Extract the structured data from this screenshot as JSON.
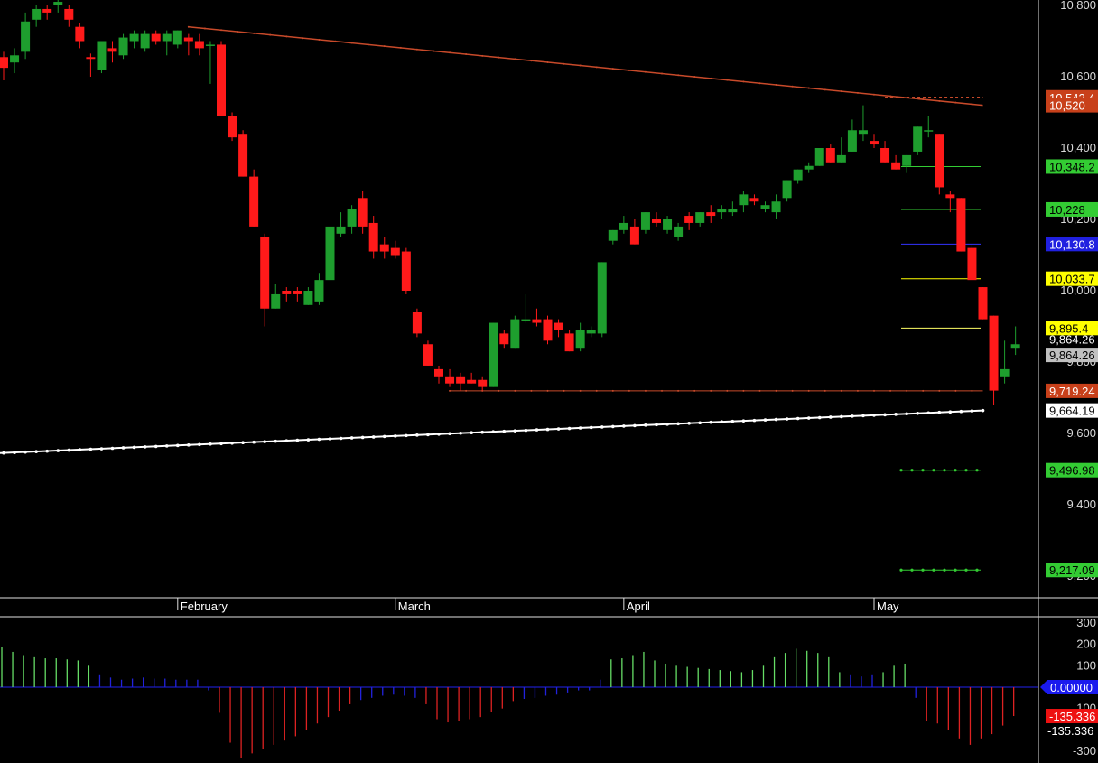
{
  "chart_data": [
    {
      "type": "candlestick",
      "ylim": [
        9160,
        10820
      ],
      "price_ticks": [
        "10,800",
        "10,600",
        "10,400",
        "10,200",
        "10,000",
        "9,800",
        "9,600",
        "9,400",
        "9,200"
      ],
      "month_labels": [
        {
          "label": "February",
          "bar": 16
        },
        {
          "label": "March",
          "bar": 36
        },
        {
          "label": "April",
          "bar": 57
        },
        {
          "label": "May",
          "bar": 80
        }
      ],
      "candles": [
        [
          10655,
          10670,
          10590,
          10625
        ],
        [
          10640,
          10680,
          10610,
          10660
        ],
        [
          10670,
          10780,
          10650,
          10755
        ],
        [
          10760,
          10800,
          10740,
          10790
        ],
        [
          10790,
          10800,
          10760,
          10780
        ],
        [
          10800,
          10830,
          10780,
          10810
        ],
        [
          10790,
          10800,
          10740,
          10760
        ],
        [
          10740,
          10750,
          10680,
          10700
        ],
        [
          10655,
          10665,
          10600,
          10650
        ],
        [
          10620,
          10700,
          10610,
          10700
        ],
        [
          10680,
          10700,
          10640,
          10670
        ],
        [
          10660,
          10720,
          10650,
          10710
        ],
        [
          10700,
          10730,
          10680,
          10720
        ],
        [
          10680,
          10730,
          10670,
          10720
        ],
        [
          10720,
          10730,
          10690,
          10700
        ],
        [
          10700,
          10730,
          10660,
          10720
        ],
        [
          10690,
          10730,
          10680,
          10730
        ],
        [
          10710,
          10720,
          10660,
          10700
        ],
        [
          10700,
          10720,
          10660,
          10680
        ],
        [
          10690,
          10700,
          10580,
          10690
        ],
        [
          10690,
          10700,
          10500,
          10490
        ],
        [
          10490,
          10500,
          10420,
          10430
        ],
        [
          10440,
          10450,
          10320,
          10320
        ],
        [
          10320,
          10340,
          10180,
          10180
        ],
        [
          10150,
          10160,
          9900,
          9950
        ],
        [
          9950,
          10020,
          9950,
          9990
        ],
        [
          10000,
          10010,
          9970,
          9990
        ],
        [
          10000,
          10010,
          9970,
          9990
        ],
        [
          9960,
          10010,
          9960,
          10000
        ],
        [
          9970,
          10050,
          9960,
          10030
        ],
        [
          10030,
          10190,
          10020,
          10180
        ],
        [
          10160,
          10220,
          10150,
          10180
        ],
        [
          10180,
          10240,
          10160,
          10230
        ],
        [
          10260,
          10280,
          10160,
          10180
        ],
        [
          10190,
          10210,
          10090,
          10110
        ],
        [
          10130,
          10150,
          10090,
          10110
        ],
        [
          10120,
          10140,
          10090,
          10100
        ],
        [
          10110,
          10120,
          9990,
          10000
        ],
        [
          9940,
          9950,
          9870,
          9880
        ],
        [
          9850,
          9860,
          9790,
          9790
        ],
        [
          9780,
          9790,
          9740,
          9760
        ],
        [
          9760,
          9780,
          9730,
          9740
        ],
        [
          9760,
          9770,
          9720,
          9740
        ],
        [
          9750,
          9770,
          9740,
          9740
        ],
        [
          9750,
          9760,
          9720,
          9730
        ],
        [
          9730,
          9910,
          9730,
          9910
        ],
        [
          9880,
          9890,
          9840,
          9850
        ],
        [
          9840,
          9930,
          9840,
          9920
        ],
        [
          9920,
          9990,
          9910,
          9920
        ],
        [
          9920,
          9950,
          9900,
          9910
        ],
        [
          9920,
          9930,
          9850,
          9860
        ],
        [
          9910,
          9920,
          9870,
          9890
        ],
        [
          9880,
          9890,
          9830,
          9830
        ],
        [
          9840,
          9910,
          9830,
          9890
        ],
        [
          9880,
          9900,
          9870,
          9890
        ],
        [
          9880,
          10080,
          9870,
          10080
        ],
        [
          10140,
          10170,
          10130,
          10170
        ],
        [
          10170,
          10210,
          10160,
          10190
        ],
        [
          10180,
          10200,
          10130,
          10130
        ],
        [
          10170,
          10220,
          10160,
          10220
        ],
        [
          10200,
          10220,
          10180,
          10190
        ],
        [
          10170,
          10210,
          10160,
          10200
        ],
        [
          10150,
          10190,
          10140,
          10180
        ],
        [
          10210,
          10220,
          10170,
          10190
        ],
        [
          10190,
          10220,
          10180,
          10220
        ],
        [
          10220,
          10240,
          10190,
          10210
        ],
        [
          10220,
          10240,
          10200,
          10230
        ],
        [
          10220,
          10250,
          10210,
          10230
        ],
        [
          10240,
          10280,
          10220,
          10270
        ],
        [
          10260,
          10270,
          10240,
          10250
        ],
        [
          10230,
          10250,
          10220,
          10240
        ],
        [
          10220,
          10270,
          10200,
          10250
        ],
        [
          10260,
          10310,
          10250,
          10310
        ],
        [
          10310,
          10340,
          10300,
          10340
        ],
        [
          10340,
          10360,
          10330,
          10350
        ],
        [
          10350,
          10400,
          10350,
          10400
        ],
        [
          10400,
          10410,
          10360,
          10360
        ],
        [
          10360,
          10430,
          10360,
          10380
        ],
        [
          10390,
          10480,
          10390,
          10450
        ],
        [
          10440,
          10520,
          10420,
          10450
        ],
        [
          10420,
          10440,
          10400,
          10410
        ],
        [
          10400,
          10420,
          10360,
          10360
        ],
        [
          10360,
          10380,
          10340,
          10340
        ],
        [
          10350,
          10380,
          10330,
          10380
        ],
        [
          10390,
          10460,
          10380,
          10460
        ],
        [
          10450,
          10490,
          10430,
          10450
        ],
        [
          10440,
          10440,
          10270,
          10290
        ],
        [
          10270,
          10280,
          10220,
          10260
        ],
        [
          10260,
          10260,
          10110,
          10110
        ],
        [
          10120,
          10130,
          10030,
          10030
        ],
        [
          10010,
          10010,
          9920,
          9920
        ],
        [
          9930,
          9930,
          9680,
          9720
        ],
        [
          9760,
          9860,
          9740,
          9780
        ],
        [
          9840,
          9900,
          9820,
          9850
        ]
      ],
      "overlays": {
        "resistance_line": {
          "from_bar": 17,
          "from_value": 10740,
          "to_bar": 90,
          "to_value": 10520
        },
        "resistance_flat": {
          "from_bar": 81,
          "to_bar": 90,
          "value": 10542.4
        },
        "support_flat": {
          "from_bar": 41,
          "to_bar": 90,
          "value": 9719.24
        },
        "moving_average": {
          "from_bar": 0,
          "from_value": 9545,
          "to_bar": 90,
          "to_value": 9664.19
        },
        "fib_levels": [
          {
            "value": 10348.2,
            "color": "#33cc33"
          },
          {
            "value": 10228,
            "color": "#33cc33"
          },
          {
            "value": 10130.8,
            "color": "#3333ff"
          },
          {
            "value": 10033.7,
            "color": "#ffff00"
          },
          {
            "value": 9895.4,
            "color": "#ffff66"
          }
        ],
        "dotted_levels": [
          {
            "value": 9496.98,
            "color": "#33cc33"
          },
          {
            "value": 9217.09,
            "color": "#33cc33"
          }
        ]
      },
      "price_tags": [
        {
          "text": "10,542.4",
          "value": 10542.4,
          "bg": "#c8401a",
          "fg": "#ffffff"
        },
        {
          "text": "10,520",
          "value": 10520,
          "bg": "#c8401a",
          "fg": "#ffffff"
        },
        {
          "text": "10,348.2",
          "value": 10348.2,
          "bg": "#33cc33",
          "fg": "#000000"
        },
        {
          "text": "10,228",
          "value": 10228,
          "bg": "#33cc33",
          "fg": "#000000"
        },
        {
          "text": "10,130.8",
          "value": 10130.8,
          "bg": "#2020e0",
          "fg": "#ffffff"
        },
        {
          "text": "10,033.7",
          "value": 10033.7,
          "bg": "#ffff00",
          "fg": "#000000"
        },
        {
          "text": "9,895.4",
          "value": 9895.4,
          "bg": "#ffff00",
          "fg": "#000000"
        },
        {
          "text": "9,864.26",
          "value": 9864.26,
          "bg": "",
          "fg": "#ffffff"
        },
        {
          "text": "9,864.26",
          "value": 9820,
          "bg": "#c0c0c0",
          "fg": "#000000"
        },
        {
          "text": "9,719.24",
          "value": 9719.24,
          "bg": "#c8401a",
          "fg": "#ffffff"
        },
        {
          "text": "9,664.19",
          "value": 9664.19,
          "bg": "#ffffff",
          "fg": "#000000"
        },
        {
          "text": "9,496.98",
          "value": 9496.98,
          "bg": "#33cc33",
          "fg": "#000000"
        },
        {
          "text": "9,217.09",
          "value": 9217.09,
          "bg": "#33cc33",
          "fg": "#000000"
        }
      ]
    },
    {
      "type": "bar",
      "ylim": [
        -340,
        300
      ],
      "ticks": [
        "300",
        "200",
        "100",
        "100",
        "-300"
      ],
      "zero_tag": "0.00000",
      "last_tag_red": "-135.336",
      "last_tag_white": "-135.336",
      "values": [
        190,
        165,
        150,
        140,
        135,
        135,
        130,
        125,
        100,
        60,
        45,
        35,
        40,
        45,
        40,
        40,
        35,
        35,
        35,
        -15,
        -120,
        -260,
        -330,
        -310,
        -290,
        -270,
        -250,
        -230,
        -200,
        -170,
        -140,
        -110,
        -80,
        -60,
        -50,
        -40,
        -35,
        -40,
        -50,
        -80,
        -150,
        -165,
        -160,
        -150,
        -140,
        -115,
        -100,
        -65,
        -55,
        -50,
        -40,
        -35,
        -25,
        -15,
        -15,
        35,
        130,
        135,
        150,
        165,
        125,
        110,
        100,
        95,
        90,
        85,
        80,
        75,
        70,
        80,
        100,
        140,
        160,
        180,
        170,
        160,
        140,
        70,
        60,
        50,
        60,
        70,
        100,
        110,
        -50,
        -160,
        -170,
        -200,
        -240,
        -270,
        -240,
        -220,
        -180,
        -135.336
      ]
    }
  ],
  "colors": {
    "background": "#000000",
    "up": "#1e9e2e",
    "down": "#ff1a1a",
    "separator": "#e0e0e0",
    "axis_text": "#d8d8d8",
    "resistance": "#c84a2a",
    "osc_pos": "#66dd66",
    "osc_neg": "#dd2222",
    "osc_mid": "#2222dd"
  }
}
